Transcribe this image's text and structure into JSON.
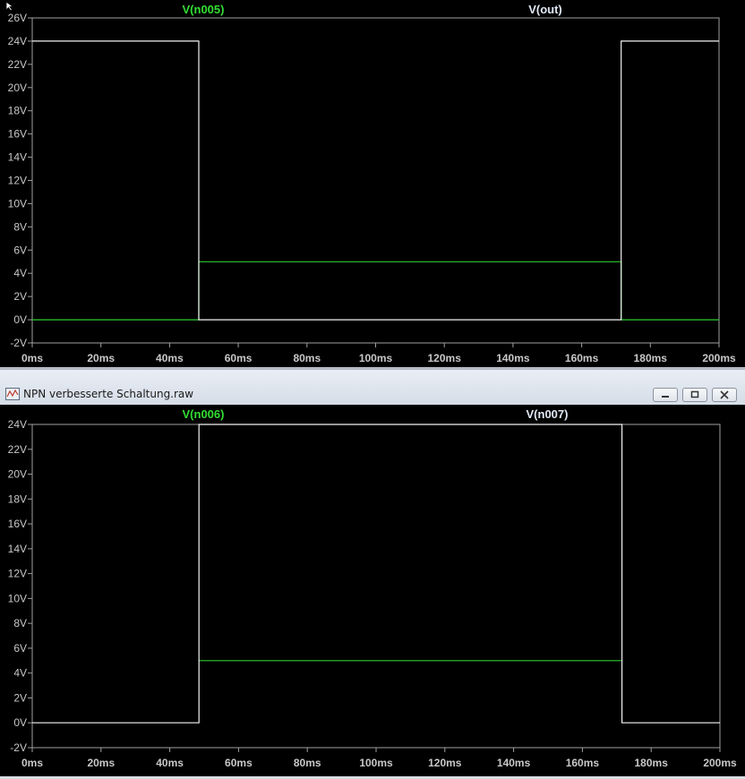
{
  "window": {
    "title": "NPN verbesserte Schaltung.raw",
    "buttons": [
      "minimize",
      "maximize",
      "close"
    ]
  },
  "colors": {
    "background": "#000000",
    "trace_green": "#2ecc2e",
    "trace_white": "#f2f2f2",
    "axis_text": "#c8c8c8",
    "label_green": "#33dd33",
    "label_white": "#dfe8f5"
  },
  "chart_data": [
    {
      "type": "line",
      "ylim": [
        -2,
        26
      ],
      "xlim": [
        0,
        200
      ],
      "yticks": [
        -2,
        0,
        2,
        4,
        6,
        8,
        10,
        12,
        14,
        16,
        18,
        20,
        22,
        24,
        26
      ],
      "ytick_labels": [
        "-2V",
        "0V",
        "2V",
        "4V",
        "6V",
        "8V",
        "10V",
        "12V",
        "14V",
        "16V",
        "18V",
        "20V",
        "22V",
        "24V",
        "26V"
      ],
      "xticks": [
        0,
        20,
        40,
        60,
        80,
        100,
        120,
        140,
        160,
        180,
        200
      ],
      "xtick_labels": [
        "0ms",
        "20ms",
        "40ms",
        "60ms",
        "80ms",
        "100ms",
        "120ms",
        "140ms",
        "160ms",
        "180ms",
        "200ms"
      ],
      "series": [
        {
          "name": "V(n005)",
          "color": "green",
          "x": [
            0,
            48.5,
            48.5,
            171.5,
            171.5,
            200
          ],
          "y": [
            0,
            0,
            5,
            5,
            0,
            0
          ]
        },
        {
          "name": "V(out)",
          "color": "white",
          "x": [
            0,
            48.5,
            48.5,
            171.5,
            171.5,
            200
          ],
          "y": [
            24,
            24,
            0,
            0,
            24,
            24
          ]
        }
      ]
    },
    {
      "type": "line",
      "ylim": [
        -2,
        24
      ],
      "xlim": [
        0,
        200
      ],
      "yticks": [
        -2,
        0,
        2,
        4,
        6,
        8,
        10,
        12,
        14,
        16,
        18,
        20,
        22,
        24
      ],
      "ytick_labels": [
        "-2V",
        "0V",
        "2V",
        "4V",
        "6V",
        "8V",
        "10V",
        "12V",
        "14V",
        "16V",
        "18V",
        "20V",
        "22V",
        "24V"
      ],
      "xticks": [
        0,
        20,
        40,
        60,
        80,
        100,
        120,
        140,
        160,
        180,
        200
      ],
      "xtick_labels": [
        "0ms",
        "20ms",
        "40ms",
        "60ms",
        "80ms",
        "100ms",
        "120ms",
        "140ms",
        "160ms",
        "180ms",
        "200ms"
      ],
      "series": [
        {
          "name": "V(n006)",
          "color": "green",
          "x": [
            48.5,
            171.5
          ],
          "y": [
            5,
            5
          ]
        },
        {
          "name": "V(n007)",
          "color": "white",
          "x": [
            0,
            48.5,
            48.5,
            171.5,
            171.5,
            200
          ],
          "y": [
            0,
            0,
            24,
            24,
            0,
            0
          ]
        }
      ]
    }
  ]
}
